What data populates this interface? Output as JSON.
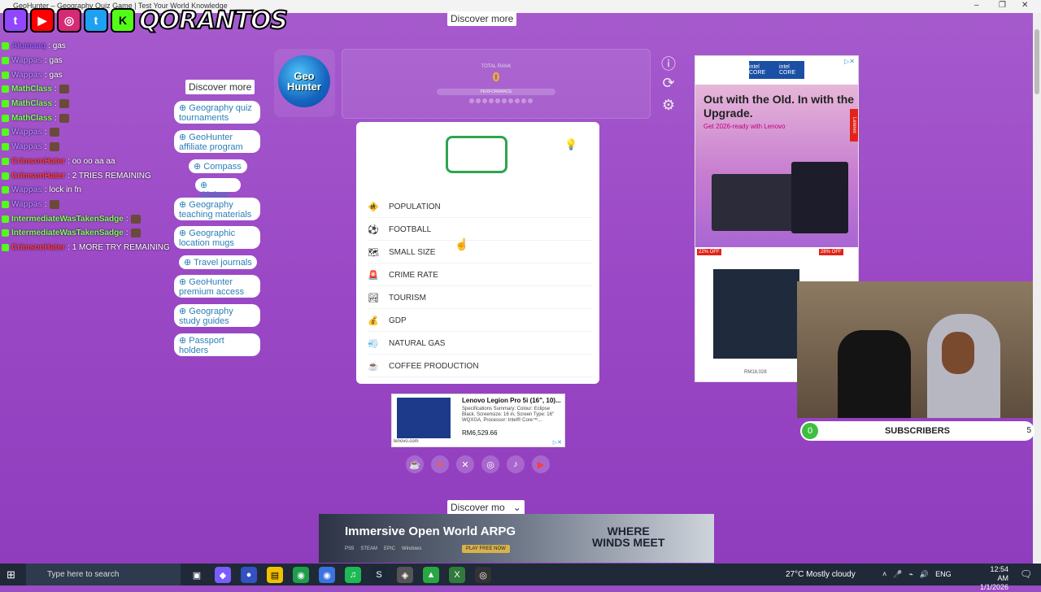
{
  "browser": {
    "title": "GeoHunter – Geography Quiz Game | Test Your World Knowledge"
  },
  "brand": {
    "name": "QORANTOS"
  },
  "chat": [
    {
      "user": "Alumaaq",
      "msg": ": gas",
      "color": "#9b59ff"
    },
    {
      "user": "Wappas",
      "msg": ": gas",
      "color": "#b07cff"
    },
    {
      "user": "Wappas",
      "msg": ": gas",
      "color": "#b07cff"
    },
    {
      "user": "MathClass",
      "msg": ":",
      "color": "#7dff5a"
    },
    {
      "user": "MathClass",
      "msg": ":",
      "color": "#7dff5a"
    },
    {
      "user": "MathClass",
      "msg": ":",
      "color": "#7dff5a"
    },
    {
      "user": "Wappas",
      "msg": ":",
      "color": "#b07cff"
    },
    {
      "user": "Wappas",
      "msg": ":",
      "color": "#b07cff"
    },
    {
      "user": "CrimsonHater",
      "msg": ": oo oo aa aa",
      "color": "#ff3b3b"
    },
    {
      "user": "CrimsonHater",
      "msg": ": 2 TRIES REMAINING",
      "color": "#ff3b3b"
    },
    {
      "user": "Wappas",
      "msg": ": lock in fn",
      "color": "#b07cff"
    },
    {
      "user": "Wappas",
      "msg": ":",
      "color": "#b07cff"
    },
    {
      "user": "IntermediateWasTakenSadge",
      "msg": ":",
      "color": "#7dff5a"
    },
    {
      "user": "IntermediateWasTakenSadge",
      "msg": ":",
      "color": "#7dff5a"
    },
    {
      "user": "CrimsonHater",
      "msg": ": 1 MORE TRY REMAINING",
      "color": "#ff3b3b"
    }
  ],
  "discover": {
    "top": "Discover more",
    "side": "Discover more",
    "bottom": "Discover mo"
  },
  "pills": [
    "⊕ Geography quiz tournaments",
    "⊕ GeoHunter affiliate program",
    "⊕ Compass",
    "⊕ Globes",
    "⊕ Geography teaching materials",
    "⊕ Geographic location mugs",
    "⊕ Travel journals",
    "⊕ GeoHunter premium access",
    "⊕ Geography study guides",
    "⊕ Passport holders"
  ],
  "game": {
    "logo_line1": "Geo",
    "logo_line2": "Hunter",
    "rank_label": "TOTAL RANK",
    "rank_value": "0",
    "performance_label": "PERFORMANCE",
    "categories": [
      {
        "icon": "🚸",
        "label": "POPULATION"
      },
      {
        "icon": "⚽",
        "label": "FOOTBALL"
      },
      {
        "icon": "🗺",
        "label": "SMALL SIZE"
      },
      {
        "icon": "🚨",
        "label": "CRIME RATE"
      },
      {
        "icon": "🏞",
        "label": "TOURISM"
      },
      {
        "icon": "💰",
        "label": "GDP"
      },
      {
        "icon": "💨",
        "label": "NATURAL GAS"
      },
      {
        "icon": "☕",
        "label": "COFFEE PRODUCTION"
      }
    ]
  },
  "ad_right": {
    "headline": "Out with the Old. In with the Upgrade.",
    "sub": "Get 2026-ready with Lenovo",
    "brand": "Lenovo",
    "intel": "intel CORE",
    "off1": "22% OFF",
    "off2": "28% OFF",
    "price": "RM18,028"
  },
  "ad_mid": {
    "title": "Lenovo Legion Pro 5i (16\", 10)...",
    "desc": "Specifications Summary: Colour: Eclipse Black, Screensize: 16 in, Screen Type: 16\" WQXGA, Processor: Intel® Core™...",
    "price": "RM6,529.66",
    "url": "lenovo.com"
  },
  "ad_bottom": {
    "headline": "Immersive Open World ARPG",
    "title_line1": "WHERE",
    "title_line2": "WINDS MEET",
    "cta": "PLAY FREE NOW",
    "platforms": [
      "PS5",
      "STEAM",
      "EPIC",
      "Windows"
    ]
  },
  "subscribers": {
    "count": "0",
    "label": "SUBSCRIBERS",
    "goal": "5"
  },
  "taskbar": {
    "search_placeholder": "Type here to search",
    "weather": "27°C  Mostly cloudy",
    "lang": "ENG",
    "time": "12:54 AM",
    "date": "1/1/2026"
  },
  "colors": {
    "accent_green": "#2ea44f",
    "rank_gold": "#f2c200",
    "pill_text": "#2b7fb8",
    "bg_purple": "#9b48c6"
  }
}
